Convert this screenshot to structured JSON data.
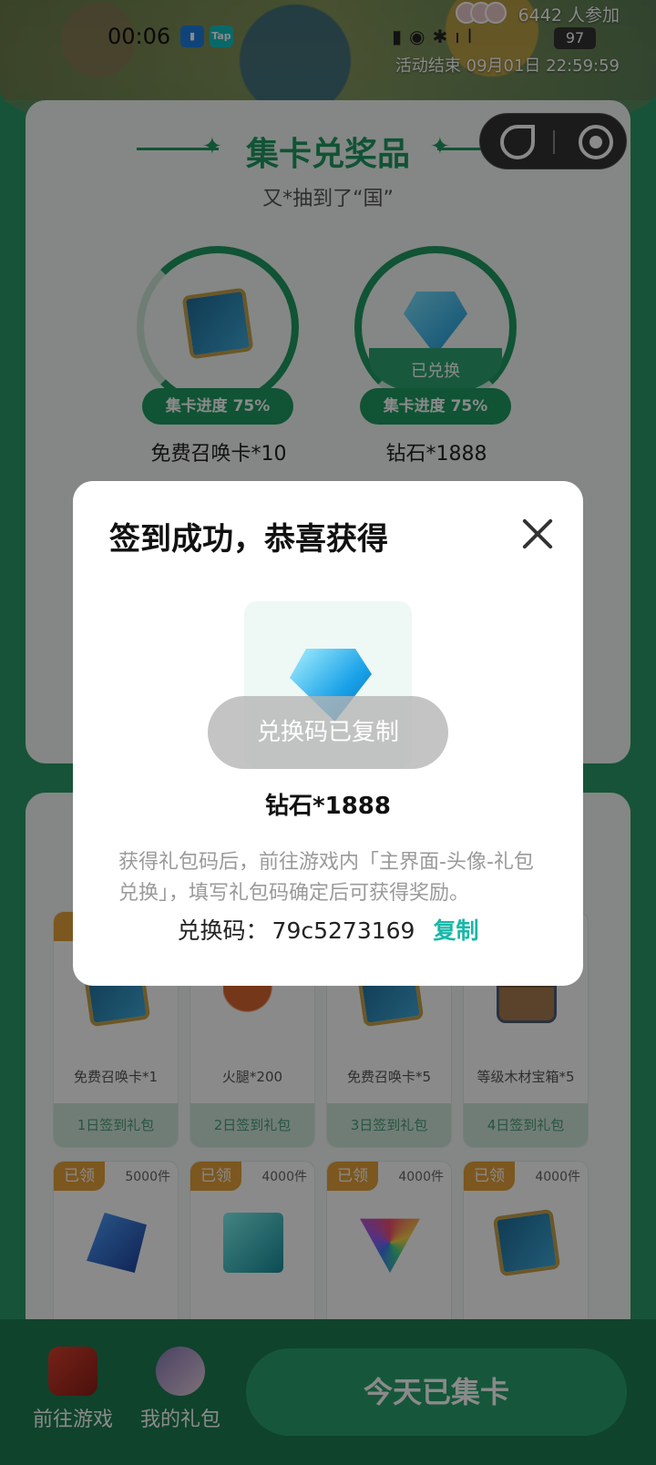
{
  "status_bar": {
    "time": "00:06",
    "app_badge_2": "Tap",
    "battery": "97"
  },
  "event": {
    "participants": "6442 人参加",
    "end_time": "活动结束 09月01日 22:59:59"
  },
  "collect": {
    "title": "集卡兑奖品",
    "lucky_message": "又*抽到了“国”",
    "prizes": [
      {
        "name": "免费召唤卡*10",
        "progress": "集卡进度 75%",
        "progress_value": 0.75,
        "redeemed": ""
      },
      {
        "name": "钻石*1888",
        "progress": "集卡进度 75%",
        "progress_value": 0.75,
        "redeemed": "已兑换"
      }
    ]
  },
  "gifts": [
    {
      "claimed": "已",
      "stock": "",
      "name": "免费召唤卡*1",
      "button": "1日签到礼包",
      "icon": "summon-card-icon"
    },
    {
      "claimed": "",
      "stock": "",
      "name": "火腿*200",
      "button": "2日签到礼包",
      "icon": "ham-icon"
    },
    {
      "claimed": "",
      "stock": "",
      "name": "免费召唤卡*5",
      "button": "3日签到礼包",
      "icon": "summon-card-icon"
    },
    {
      "claimed": "",
      "stock": "件",
      "name": "等级木材宝箱*5",
      "button": "4日签到礼包",
      "icon": "chest-icon"
    },
    {
      "claimed": "已领",
      "stock": "5000件",
      "name": "",
      "button": "",
      "icon": "blue-gem-icon"
    },
    {
      "claimed": "已领",
      "stock": "4000件",
      "name": "",
      "button": "",
      "icon": "teal-box-icon"
    },
    {
      "claimed": "已领",
      "stock": "4000件",
      "name": "",
      "button": "",
      "icon": "prism-icon"
    },
    {
      "claimed": "已领",
      "stock": "4000件",
      "name": "",
      "button": "",
      "icon": "summon-card-icon"
    }
  ],
  "bottom_bar": {
    "goto_game": "前往游戏",
    "my_gifts": "我的礼包",
    "checkin": "今天已集卡"
  },
  "modal": {
    "title": "签到成功，恭喜获得",
    "reward_name": "钻石*1888",
    "reward_icon": "diamond-icon",
    "instructions": "获得礼包码后，前往游戏内「主界面-头像-礼包兑换」，填写礼包码确定后可获得奖励。",
    "code_label": "兑换码：",
    "code_value": "79c5273169",
    "copy_label": "复制"
  },
  "toast": "兑换码已复制",
  "colors": {
    "brand_green": "#1f9a62",
    "copy_link": "#1ab7a8",
    "claimed_badge": "#e5a13a"
  }
}
